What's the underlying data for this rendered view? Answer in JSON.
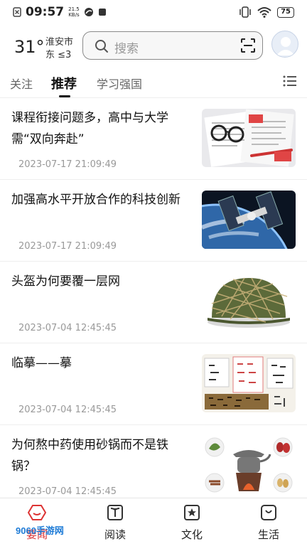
{
  "status_bar": {
    "time": "09:57",
    "speed_value": "21.5",
    "speed_unit": "KB/s",
    "battery": "75"
  },
  "header": {
    "temperature": "31°",
    "city": "淮安市",
    "wind": "东 ≤3",
    "search_placeholder": "搜索"
  },
  "tabs": [
    {
      "label": "关注",
      "active": false
    },
    {
      "label": "推荐",
      "active": true
    },
    {
      "label": "学习强国",
      "active": false
    }
  ],
  "articles": [
    {
      "title": "课程衔接问题多，高中与大学需“双向奔赴”",
      "time": "2023-07-17 21:09:49",
      "thumb": "documents-glasses"
    },
    {
      "title": "加强高水平开放合作的科技创新",
      "time": "2023-07-17 21:09:49",
      "thumb": "space-station"
    },
    {
      "title": "头盔为何要覆一层网",
      "time": "2023-07-04 12:45:45",
      "thumb": "netted-helmet"
    },
    {
      "title": "临摹——摹",
      "time": "2023-07-04 12:45:45",
      "thumb": "calligraphy"
    },
    {
      "title": "为何熬中药使用砂锅而不是铁锅？",
      "time": "2023-07-04 12:45:45",
      "thumb": "herbal-pot"
    }
  ],
  "bottom_nav": [
    {
      "label": "要闻",
      "active": true
    },
    {
      "label": "阅读",
      "active": false
    },
    {
      "label": "文化",
      "active": false
    },
    {
      "label": "生活",
      "active": false
    }
  ],
  "watermark": "9060手游网",
  "colors": {
    "accent": "#d33333",
    "text": "#111111",
    "muted": "#999999"
  }
}
